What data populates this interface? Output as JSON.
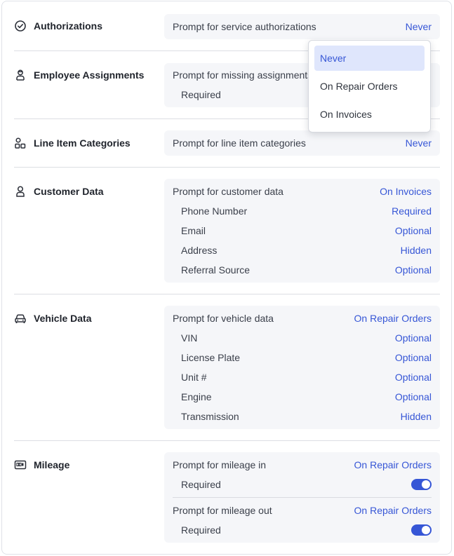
{
  "authorizations": {
    "title": "Authorizations",
    "icon": "check-circle-icon",
    "prompt": "Prompt for service authorizations",
    "value": "Never"
  },
  "employee_assignments": {
    "title": "Employee Assignments",
    "icon": "technician-icon",
    "prompt": "Prompt for missing assignments",
    "sub_label": "Required"
  },
  "dropdown": {
    "options": [
      "Never",
      "On Repair Orders",
      "On Invoices"
    ],
    "selected": "Never"
  },
  "line_item_categories": {
    "title": "Line Item Categories",
    "icon": "categories-icon",
    "prompt": "Prompt for line item categories",
    "value": "Never"
  },
  "customer_data": {
    "title": "Customer Data",
    "icon": "person-icon",
    "prompt": "Prompt for customer data",
    "value": "On Invoices",
    "fields": [
      {
        "label": "Phone Number",
        "value": "Required"
      },
      {
        "label": "Email",
        "value": "Optional"
      },
      {
        "label": "Address",
        "value": "Hidden"
      },
      {
        "label": "Referral Source",
        "value": "Optional"
      }
    ]
  },
  "vehicle_data": {
    "title": "Vehicle Data",
    "icon": "car-icon",
    "prompt": "Prompt for vehicle data",
    "value": "On Repair Orders",
    "fields": [
      {
        "label": "VIN",
        "value": "Optional"
      },
      {
        "label": "License Plate",
        "value": "Optional"
      },
      {
        "label": "Unit #",
        "value": "Optional"
      },
      {
        "label": "Engine",
        "value": "Optional"
      },
      {
        "label": "Transmission",
        "value": "Hidden"
      }
    ]
  },
  "mileage": {
    "title": "Mileage",
    "icon": "odometer-icon",
    "in_prompt": "Prompt for mileage in",
    "in_value": "On Repair Orders",
    "in_required": "Required",
    "out_prompt": "Prompt for mileage out",
    "out_value": "On Repair Orders",
    "out_required": "Required"
  },
  "colors": {
    "accent": "#3656d6",
    "panel": "#f5f6f9",
    "selected_bg": "#dfe6fc"
  }
}
